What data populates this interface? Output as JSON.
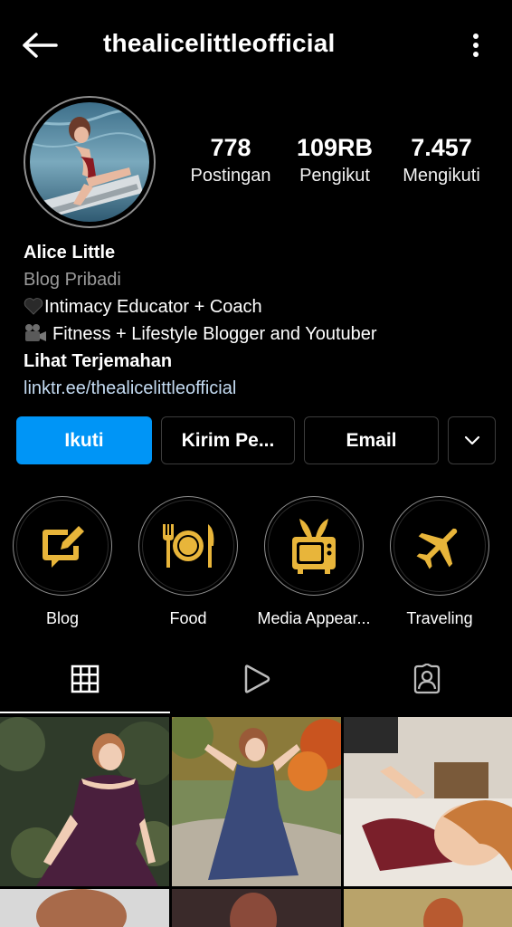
{
  "header": {
    "username": "thealicelittleofficial",
    "back_icon": "arrow-left-icon",
    "more_icon": "vertical-dots-icon"
  },
  "stats": [
    {
      "value": "778",
      "label": "Postingan"
    },
    {
      "value": "109RB",
      "label": "Pengikut"
    },
    {
      "value": "7.457",
      "label": "Mengikuti"
    }
  ],
  "bio": {
    "name": "Alice Little",
    "category": "Blog Pribadi",
    "line1": "Intimacy Educator + Coach",
    "line2": "Fitness + Lifestyle Blogger and Youtuber",
    "translate": "Lihat Terjemahan",
    "link": "linktr.ee/thealicelittleofficial"
  },
  "actions": {
    "follow": "Ikuti",
    "message": "Kirim Pe...",
    "email": "Email",
    "more_icon": "chevron-down-icon"
  },
  "highlights": [
    {
      "label": "Blog",
      "icon": "edit-message-icon"
    },
    {
      "label": "Food",
      "icon": "plate-utensils-icon"
    },
    {
      "label": "Media Appear...",
      "icon": "tv-icon"
    },
    {
      "label": "Traveling",
      "icon": "airplane-icon"
    }
  ],
  "tabs": [
    {
      "name": "posts",
      "icon": "grid-icon"
    },
    {
      "name": "reels",
      "icon": "play-icon"
    },
    {
      "name": "tagged",
      "icon": "tagged-user-icon"
    }
  ],
  "colors": {
    "accent": "#0095f6",
    "highlight_gold": "#e8b53a",
    "link": "#c4dbf2",
    "muted": "#9a9a9a"
  }
}
